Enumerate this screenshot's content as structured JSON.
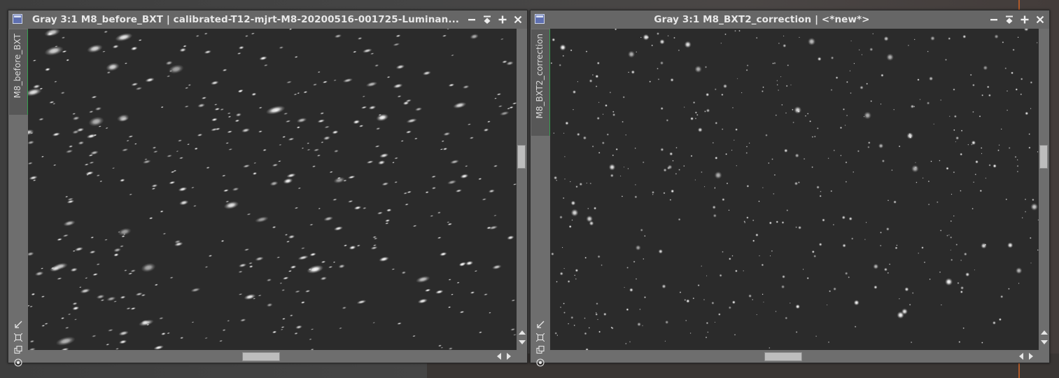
{
  "desktop": {
    "background": "#434343",
    "accent": "#b05a2a"
  },
  "windows": [
    {
      "id": "left",
      "title": "Gray 3:1 M8_before_BXT | calibrated-T12-mjrt-M8-20200516-001725-Luminan...",
      "view_tab": "M8_before_BXT",
      "image": {
        "kind": "star-field",
        "star_shape": "elongated",
        "background_level": "#2b2b2b"
      }
    },
    {
      "id": "right",
      "title": "Gray 3:1 M8_BXT2_correction | <*new*>",
      "view_tab": "M8_BXT2_correction",
      "image": {
        "kind": "star-field",
        "star_shape": "round",
        "background_level": "#2b2b2b"
      }
    }
  ],
  "title_controls": [
    "minimize-icon",
    "shade-icon",
    "maximize-icon",
    "close-icon"
  ],
  "side_tools": [
    "fit-view-icon",
    "zoom-window-icon",
    "clone-view-icon",
    "target-icon"
  ],
  "colors": {
    "titlebar": "#666666",
    "tab_accent": "#35a050",
    "scroll_thumb": "#bdbdbd",
    "window_frame": "#6e6e6e"
  }
}
